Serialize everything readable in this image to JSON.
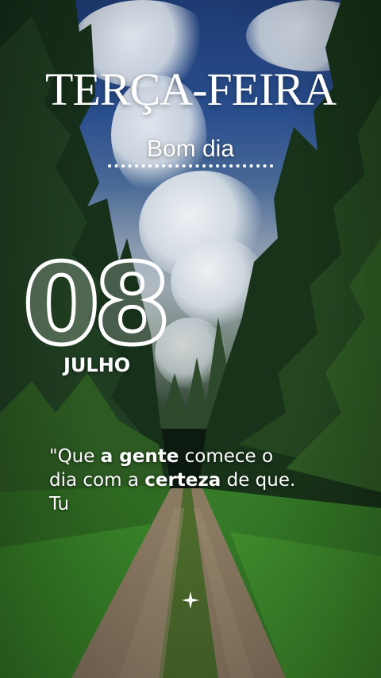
{
  "post": {
    "weekday": "TERÇA-FEIRA",
    "greeting": "Bom dia",
    "day_number": "08",
    "month": "JULHO",
    "quote": {
      "line1_a": "\"Que ",
      "line1_b": "a gente",
      "line1_c": " comece o",
      "line2_a": "dia com a ",
      "line2_b": "certeza",
      "line2_c": " de que.",
      "line3": "Tu"
    }
  },
  "colors": {
    "text": "#ffffff",
    "sky": "#2a4f8e",
    "forest": "#1f3b22",
    "grass": "#3f8a2e",
    "road": "#8b7a62"
  },
  "icons": {
    "sparkle": "four-point-star-icon"
  }
}
